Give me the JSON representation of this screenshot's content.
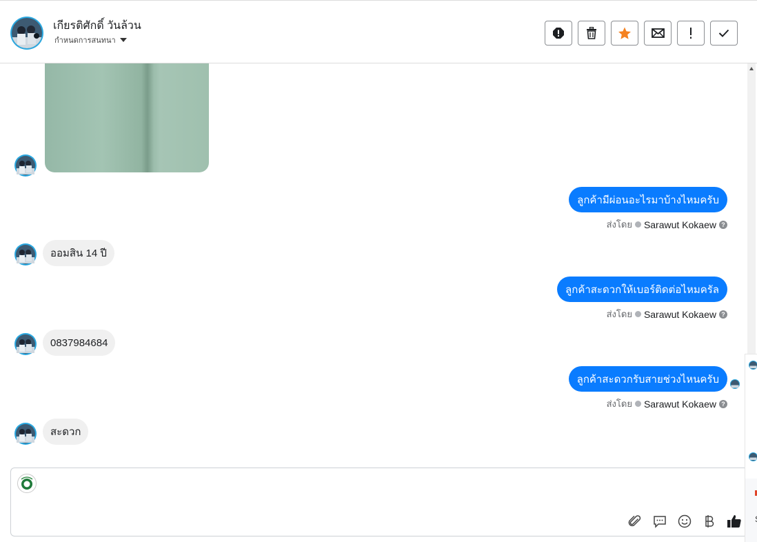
{
  "header": {
    "contact_name": "เกียรติศักดิ์ วันล้วน",
    "label_selector": "กำหนดการสนทนา",
    "tools": [
      {
        "name": "report-icon",
        "title": "report"
      },
      {
        "name": "trash-icon",
        "title": "delete"
      },
      {
        "name": "star-icon",
        "title": "star",
        "color": "#f58220"
      },
      {
        "name": "mail-icon",
        "title": "mark-unread"
      },
      {
        "name": "exclamation-icon",
        "title": "important"
      },
      {
        "name": "check-icon",
        "title": "done"
      }
    ]
  },
  "messages": [
    {
      "direction": "in",
      "type": "image",
      "image_color": "#9fc0ae"
    },
    {
      "direction": "out",
      "text": "ลูกค้ามีผ่อนอะไรมาบ้างไหมครับ",
      "sent_by_label": "ส่งโดย",
      "agent": "Sarawut Kokaew"
    },
    {
      "direction": "in",
      "text": "ออมสิน 14 ปี"
    },
    {
      "direction": "out",
      "text": "ลูกค้าสะดวกให้เบอร์ติดต่อไหมครัล",
      "sent_by_label": "ส่งโดย",
      "agent": "Sarawut Kokaew"
    },
    {
      "direction": "in",
      "text": "0837984684"
    },
    {
      "direction": "out",
      "text": "ลูกค้าสะดวกรับสายช่วงไหนครับ",
      "sent_by_label": "ส่งโดย",
      "agent": "Sarawut Kokaew"
    },
    {
      "direction": "in",
      "text": "สะดวก"
    }
  ],
  "composer": {
    "placeholder": "",
    "tools": [
      "paperclip-icon",
      "speech-bubble-icon",
      "smiley-icon",
      "baht-icon",
      "thumbs-up-icon"
    ]
  },
  "side_peek": {
    "text": "S"
  },
  "colors": {
    "outgoing_bubble": "#0a7cff",
    "incoming_bubble": "#f0f0f0",
    "accent_star": "#f58220"
  }
}
